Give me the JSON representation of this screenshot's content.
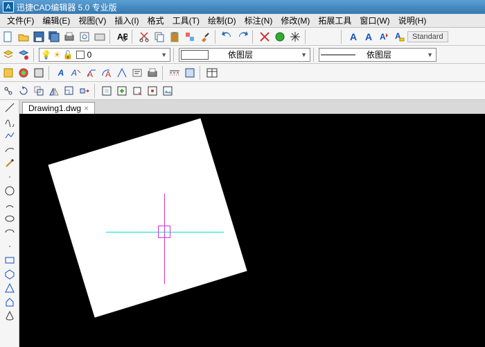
{
  "title": "迅捷CAD编辑器 5.0 专业版",
  "menu": [
    "文件(F)",
    "编辑(E)",
    "视图(V)",
    "插入(I)",
    "格式",
    "工具(T)",
    "绘制(D)",
    "标注(N)",
    "修改(M)",
    "拓展工具",
    "窗口(W)",
    "说明(H)"
  ],
  "toolbar1_icons": [
    "new-icon",
    "open-icon",
    "save-icon",
    "saveas-icon",
    "print-icon",
    "preview-icon",
    "plot-icon",
    "find-icon",
    "cut-icon",
    "copy-icon",
    "paste-icon",
    "match-icon",
    "brush-icon",
    "undo-icon",
    "redo-icon",
    "erase-icon",
    "pan-icon",
    "zoom-icon"
  ],
  "toolbar1_textstyle_icons": [
    "text-a-icon",
    "text-a-bold-icon",
    "text-style-icon",
    "text-ruler-icon"
  ],
  "style_label": "Standard",
  "layer_current": "0",
  "layer_combo2": "依图层",
  "layer_combo3": "依图层",
  "colors": {
    "bylayer_swatch": "#ffffff",
    "accent": "#0b62a8"
  },
  "toolbar2_icons": [
    "layer-icon",
    "layer-state-icon",
    "bulb-icon",
    "sun-icon",
    "lock-icon",
    "color-icon"
  ],
  "toolbar3_icons": [
    "hatch-icon",
    "gradient-icon",
    "region-icon",
    "dim-a-icon",
    "dim-b-icon",
    "leader-icon",
    "angle-icon",
    "arc-dim-icon",
    "text-multi-icon",
    "print2-icon",
    "dash-icon",
    "layers2-icon",
    "table-icon"
  ],
  "toolbar4_icons": [
    "t1",
    "t2",
    "t3",
    "t4",
    "t5",
    "t6",
    "t7",
    "t8",
    "t9",
    "t10",
    "t11",
    "t12"
  ],
  "left_tools": [
    "line-icon",
    "spline-icon",
    "polyline-icon",
    "arc-icon",
    "pencil-icon",
    "dot",
    "circle-icon",
    "arc2-icon",
    "ellipse-icon",
    "ellipse-arc-icon",
    "dot",
    "rect-icon",
    "polygon-icon",
    "triangle-icon",
    "home-icon",
    "cone-icon"
  ],
  "tab": {
    "name": "Drawing1.dwg",
    "close": "×"
  }
}
